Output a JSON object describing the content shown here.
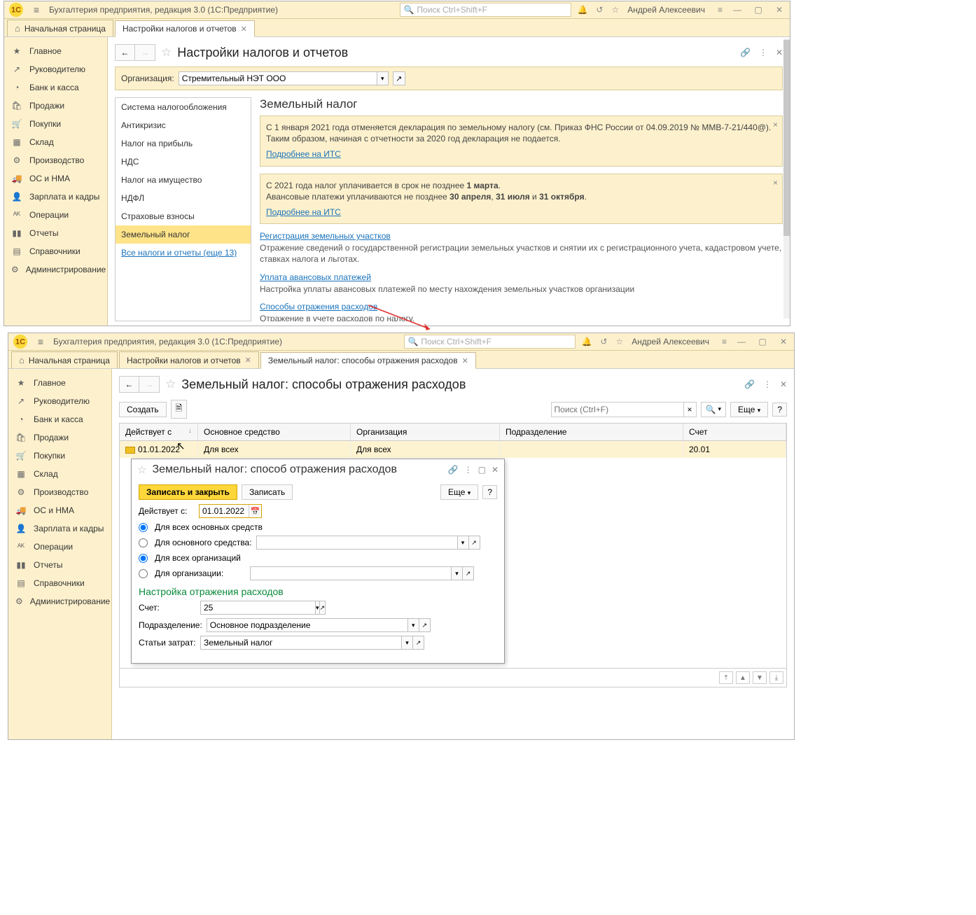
{
  "app": {
    "title": "Бухгалтерия предприятия, редакция 3.0  (1С:Предприятие)",
    "search_placeholder": "Поиск Ctrl+Shift+F",
    "user": "Андрей Алексеевич"
  },
  "tabs1": {
    "home": "Начальная страница",
    "t1": "Настройки налогов и отчетов"
  },
  "sidebar": {
    "items": [
      "Главное",
      "Руководителю",
      "Банк и касса",
      "Продажи",
      "Покупки",
      "Склад",
      "Производство",
      "ОС и НМА",
      "Зарплата и кадры",
      "Операции",
      "Отчеты",
      "Справочники",
      "Администрирование"
    ]
  },
  "page1": {
    "title": "Настройки налогов и отчетов",
    "org_label": "Организация:",
    "org_value": "Стремительный НЭТ ООО",
    "nav": [
      "Система налогообложения",
      "Антикризис",
      "Налог на прибыль",
      "НДС",
      "Налог на имущество",
      "НДФЛ",
      "Страховые взносы",
      "Земельный налог"
    ],
    "nav_link": "Все налоги и отчеты (еще 13)",
    "section_title": "Земельный налог",
    "info1": "С 1 января 2021 года отменяется декларация по земельному налогу (см. Приказ ФНС России от 04.09.2019 № ММВ-7-21/440@). Таким образом, начиная с отчетности за 2020 год декларация не подается.",
    "info1_link": "Подробнее на ИТС",
    "info2_a": "С 2021 года налог уплачивается в срок не позднее ",
    "info2_b": "1 марта",
    "info2_c": "Авансовые платежи уплачиваются не позднее ",
    "info2_d": "30 апреля",
    "info2_e": "31 июля",
    "info2_f": "31 октября",
    "info2_link": "Подробнее на ИТС",
    "link_reg": "Регистрация земельных участков",
    "desc_reg": "Отражение сведений о государственной регистрации земельных участков и снятии их с регистрационного учета, кадастровом учете, ставках налога и льготах.",
    "link_avans": "Уплата авансовых платежей",
    "desc_avans": "Настройка уплаты авансовых платежей по месту нахождения земельных участков организации",
    "link_ways": "Способы отражения расходов",
    "desc_ways": "Отражение в учете расходов по налогу."
  },
  "tabs2": {
    "home": "Начальная страница",
    "t1": "Настройки налогов и отчетов",
    "t2": "Земельный налог: способы отражения расходов"
  },
  "page2": {
    "title": "Земельный налог: способы отражения расходов",
    "btn_create": "Создать",
    "search_placeholder": "Поиск (Ctrl+F)",
    "btn_more": "Еще",
    "headers": [
      "Действует с",
      "Основное средство",
      "Организация",
      "Подразделение",
      "Счет"
    ],
    "row": {
      "date": "01.01.2022",
      "os": "Для всех",
      "org": "Для всех",
      "dept": "",
      "account": "20.01"
    }
  },
  "modal": {
    "title": "Земельный налог: способ отражения расходов",
    "btn_save_close": "Записать и закрыть",
    "btn_save": "Записать",
    "btn_more": "Еще",
    "lbl_valid_from": "Действует с:",
    "val_valid_from": "01.01.2022",
    "opt_all_os": "Для всех основных средств",
    "opt_one_os": "Для основного средства:",
    "opt_all_org": "Для всех организаций",
    "opt_one_org": "Для организации:",
    "section": "Настройка отражения расходов",
    "lbl_account": "Счет:",
    "val_account": "25",
    "lbl_dept": "Подразделение:",
    "val_dept": "Основное подразделение",
    "lbl_cost": "Статьи затрат:",
    "val_cost": "Земельный налог"
  }
}
